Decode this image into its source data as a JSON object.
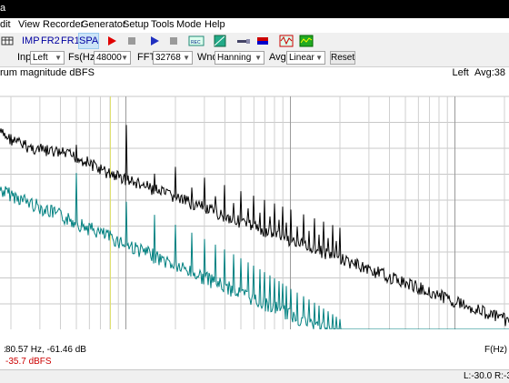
{
  "title": {
    "text": "a"
  },
  "menu": [
    "dit",
    "View",
    "Recorder",
    "Generator",
    "Setup",
    "Tools",
    "Mode",
    "Help"
  ],
  "toolbar": {
    "modes": [
      "IMP",
      "FR2",
      "FR1",
      "SPA"
    ],
    "active_mode": "SPA",
    "icons": [
      "table-icon",
      "record-icon",
      "stop-icon",
      "play-icon",
      "stop-icon",
      "record-file-icon",
      "spectrogram-icon",
      "probe-icon",
      "flag-icon",
      "oscilloscope-icon",
      "analyzer-icon"
    ]
  },
  "controls": {
    "inp_label": "Inp",
    "inp_value": "Left",
    "fs_label": "Fs(Hz)",
    "fs_value": "48000",
    "fft_label": "FFT",
    "fft_value": "32768",
    "wnd_label": "Wnd",
    "wnd_value": "Hanning",
    "avg_label": "Avg",
    "avg_value": "Linear",
    "reset_label": "Reset"
  },
  "plot": {
    "title": "rum magnitude dBFS",
    "channel": "Left",
    "avg": "Avg:38",
    "cursor_readout": "80.57 Hz, -61.46 dB",
    "cursor_prefix": ":",
    "level_readout": "-35.7 dBFS",
    "xaxis_label": "F(Hz)"
  },
  "chart_data": {
    "type": "line",
    "xlabel": "F(Hz)",
    "ylabel": "",
    "x_scale": "log",
    "x_ticks": [
      "50",
      "100",
      "200",
      "500",
      "1k",
      "2k",
      "5k",
      "10k",
      "20"
    ],
    "grid": true,
    "cursor_hz": 80.57,
    "series": [
      {
        "name": "",
        "color": "#000000"
      },
      {
        "name": "",
        "color": "#008080"
      }
    ]
  },
  "status": {
    "left": "L:-30.0",
    "right": "R:-3"
  }
}
